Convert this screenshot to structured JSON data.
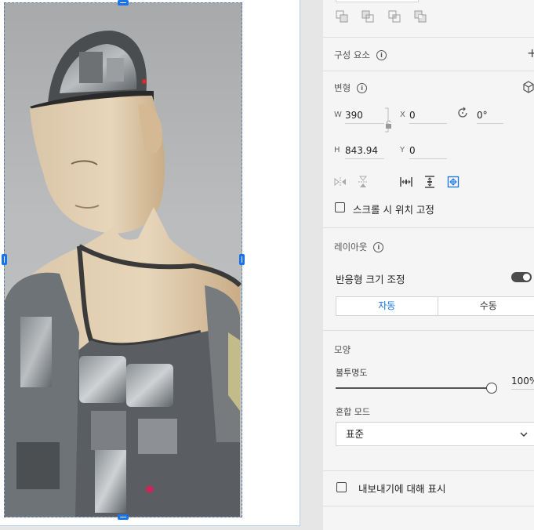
{
  "panel": {
    "components": {
      "title": "구성 요소",
      "add_label": "+"
    },
    "transform": {
      "title": "변형",
      "w_label": "W",
      "w_value": "390",
      "x_label": "X",
      "x_value": "0",
      "rotation_value": "0°",
      "h_label": "H",
      "h_value": "843.94",
      "y_label": "Y",
      "y_value": "0",
      "fix_position_label": "스크롤 시 위치 고정"
    },
    "layout": {
      "title": "레이아웃",
      "responsive_label": "반응형 크기 조정",
      "auto_label": "자동",
      "manual_label": "수동"
    },
    "appearance": {
      "title": "모양",
      "opacity_label": "불투명도",
      "opacity_value": "100%",
      "opacity_fraction": 1.0,
      "blend_label": "혼합 모드",
      "blend_value": "표준"
    },
    "export": {
      "label": "내보내기에 대해 표시"
    }
  },
  "colors": {
    "accent": "#1473e6",
    "handle": "#1a73e8"
  }
}
